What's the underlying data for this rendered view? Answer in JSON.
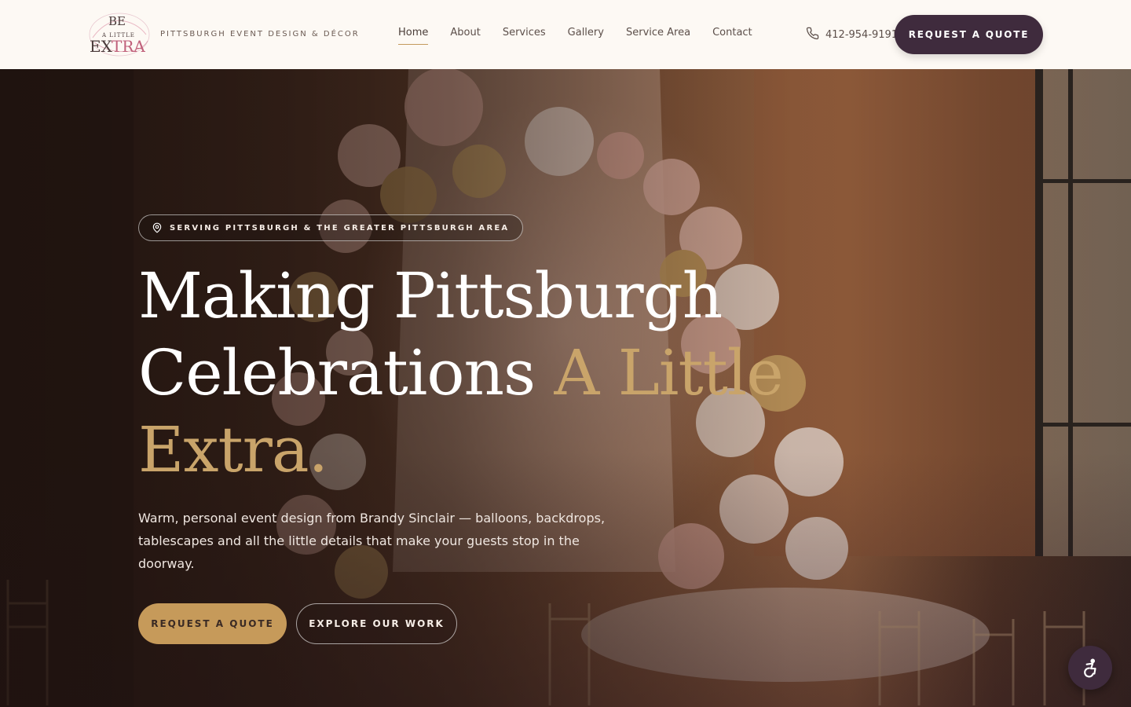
{
  "brand": {
    "logo_alt": "Be A Little Extra",
    "tagline": "PITTSBURGH EVENT DESIGN & DÉCOR"
  },
  "nav": {
    "items": [
      {
        "label": "Home",
        "active": true
      },
      {
        "label": "About",
        "active": false
      },
      {
        "label": "Services",
        "active": false
      },
      {
        "label": "Gallery",
        "active": false
      },
      {
        "label": "Service Area",
        "active": false
      },
      {
        "label": "Contact",
        "active": false
      }
    ]
  },
  "header": {
    "phone": "412-954-9191",
    "cta_label": "REQUEST A QUOTE"
  },
  "hero": {
    "badge": "SERVING PITTSBURGH & THE GREATER PITTSBURGH AREA",
    "headline_line1": "Making Pittsburgh",
    "headline_line2": "Celebrations",
    "headline_accent_1": "A Little",
    "headline_accent_2": "Extra.",
    "lead": "Warm, personal event design from Brandy Sinclair — balloons, backdrops, tablescapes and all the little details that make your guests stop in the doorway.",
    "primary_cta": "REQUEST A QUOTE",
    "secondary_cta": "EXPLORE OUR WORK"
  },
  "icons": {
    "phone": "phone-icon",
    "location": "location-pin-icon",
    "accessibility": "accessibility-icon"
  },
  "colors": {
    "header_bg": "#fdf9f4",
    "plum": "#3f2b3d",
    "gold": "#c69a5a",
    "gold_text": "#c9a46a"
  }
}
